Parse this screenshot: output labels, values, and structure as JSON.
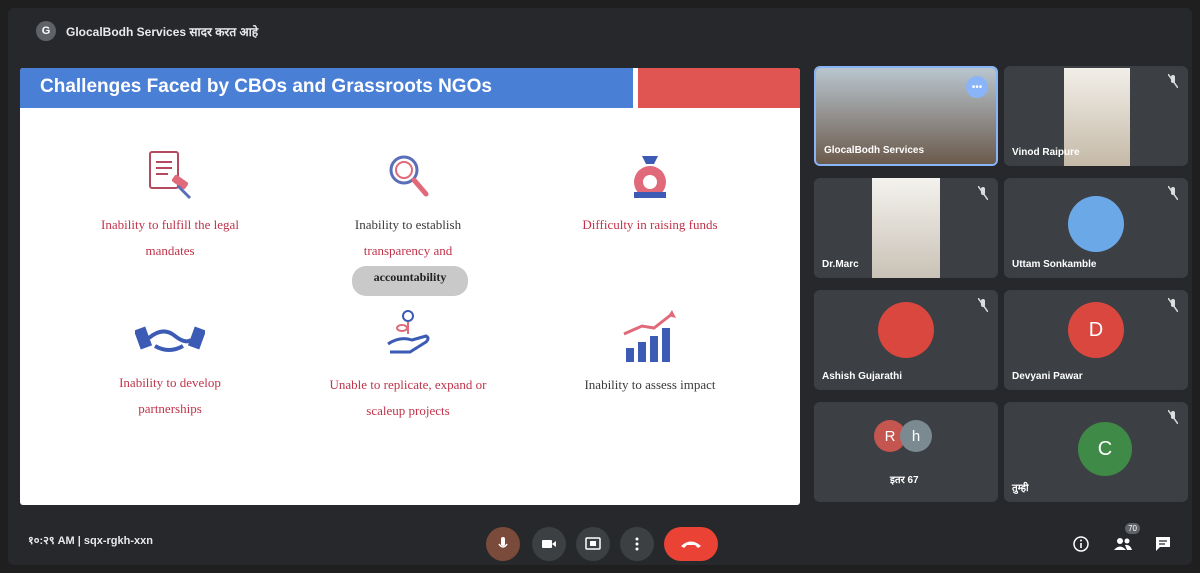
{
  "topbar": {
    "presenter_initial": "G",
    "presenting_text": "GlocalBodh Services सादर करत आहे"
  },
  "slide": {
    "title": "Challenges Faced by CBOs and Grassroots NGOs",
    "items": [
      {
        "label_line1": "Inability to fulfill the legal",
        "label_line2": "mandates",
        "icon": "legal-document-gavel-icon"
      },
      {
        "label_line1": "Inability to establish",
        "label_line2": "transparency and",
        "icon": "magnifying-glass-icon"
      },
      {
        "label_line1": "Difficulty in raising funds",
        "label_line2": "",
        "icon": "money-bag-icon"
      },
      {
        "label_line1": "Inability to develop",
        "label_line2": "partnerships",
        "icon": "handshake-icon"
      },
      {
        "label_line1": "Unable to replicate, expand or",
        "label_line2": "scaleup projects",
        "icon": "hand-plant-icon"
      },
      {
        "label_line1": "Inability to assess impact",
        "label_line2": "",
        "icon": "growth-bar-chart-icon"
      }
    ],
    "caption_overlay": "accountability"
  },
  "participants": [
    {
      "name": "GlocalBodh Services"
    },
    {
      "name": "Vinod Raipure"
    },
    {
      "name": "Dr.Marc"
    },
    {
      "name": "Uttam Sonkamble"
    },
    {
      "name": "Ashish Gujarathi"
    },
    {
      "name": "Devyani Pawar",
      "initial": "D"
    },
    {
      "name": "इतर 67",
      "initials": [
        "R",
        "h"
      ]
    },
    {
      "name": "तुम्ही",
      "initial": "C"
    }
  ],
  "bottombar": {
    "meeting_info": "१०:२९ AM | sqx-rgkh-xxn",
    "participant_count": "70"
  },
  "colors": {
    "accent_blue": "#4a7fd6",
    "accent_red": "#e05452",
    "end_call": "#ea4335"
  }
}
